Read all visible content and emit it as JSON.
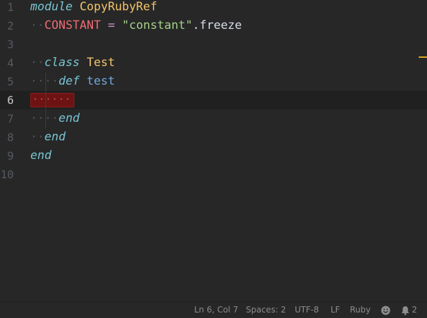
{
  "editor": {
    "line_numbers": [
      "1",
      "2",
      "3",
      "4",
      "5",
      "6",
      "7",
      "8",
      "9",
      "10"
    ],
    "active_line_index": 5,
    "lines": [
      {
        "tokens": [
          {
            "text": "module",
            "cls": "kw"
          },
          {
            "text": " ",
            "cls": "plain"
          },
          {
            "text": "CopyRubyRef",
            "cls": "const-class"
          }
        ]
      },
      {
        "tokens": [
          {
            "text": "··",
            "cls": "ws"
          },
          {
            "text": "CONSTANT",
            "cls": "const"
          },
          {
            "text": " ",
            "cls": "plain"
          },
          {
            "text": "=",
            "cls": "op"
          },
          {
            "text": " ",
            "cls": "plain"
          },
          {
            "text": "\"constant\"",
            "cls": "str"
          },
          {
            "text": ".",
            "cls": "dot"
          },
          {
            "text": "freeze",
            "cls": "plain"
          }
        ]
      },
      {
        "tokens": []
      },
      {
        "tokens": [
          {
            "text": "··",
            "cls": "ws"
          },
          {
            "text": "class",
            "cls": "kw"
          },
          {
            "text": " ",
            "cls": "plain"
          },
          {
            "text": "Test",
            "cls": "const-class"
          }
        ]
      },
      {
        "tokens": [
          {
            "text": "····",
            "cls": "ws"
          },
          {
            "text": "def",
            "cls": "kw"
          },
          {
            "text": " ",
            "cls": "plain"
          },
          {
            "text": "test",
            "cls": "fn"
          }
        ]
      },
      {
        "tokens": [],
        "trailing_whitespace": "······"
      },
      {
        "tokens": [
          {
            "text": "····",
            "cls": "ws"
          },
          {
            "text": "end",
            "cls": "kw"
          }
        ]
      },
      {
        "tokens": [
          {
            "text": "··",
            "cls": "ws"
          },
          {
            "text": "end",
            "cls": "kw"
          }
        ]
      },
      {
        "tokens": [
          {
            "text": "end",
            "cls": "kw"
          }
        ]
      },
      {
        "tokens": []
      }
    ]
  },
  "colors": {
    "keyword": "#79c6d4",
    "class_name": "#f3c46a",
    "constant": "#ef6b73",
    "string": "#a6d18a",
    "method_name": "#6fa8dc",
    "operator": "#c594c5",
    "trailing_whitespace_highlight": "#6e1313",
    "scrollbar_marker": "#e0a81c"
  },
  "statusbar": {
    "cursor_position": "Ln 6, Col 7",
    "indentation": "Spaces: 2",
    "encoding": "UTF-8",
    "line_ending": "LF",
    "language": "Ruby",
    "feedback_icon": "smiley-icon",
    "notifications_icon": "bell-icon",
    "notifications_count": "2"
  }
}
